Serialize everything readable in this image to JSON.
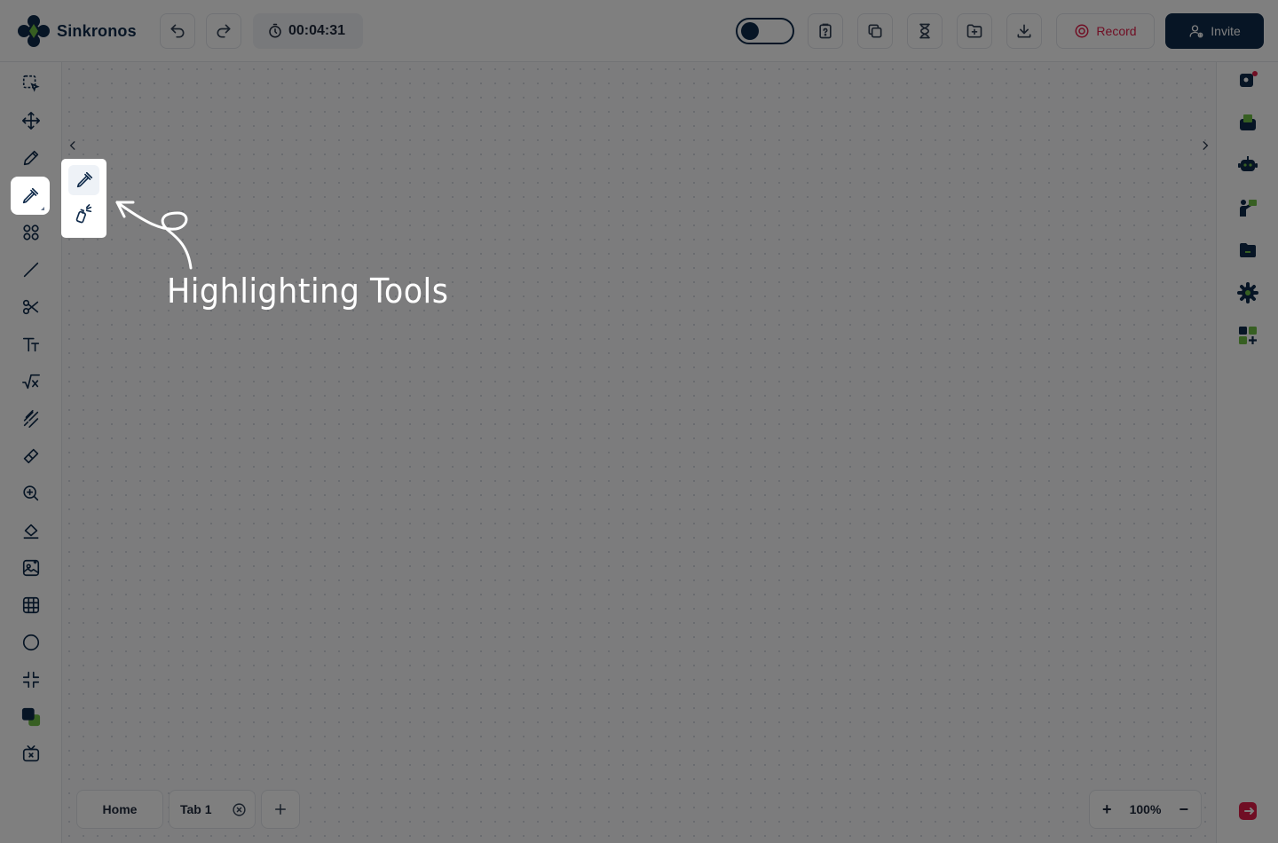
{
  "app": {
    "name": "Sinkronos"
  },
  "header": {
    "timer": "00:04:31",
    "record_label": "Record",
    "invite_label": "Invite"
  },
  "tabs": [
    {
      "label": "Home"
    },
    {
      "label": "Tab 1"
    }
  ],
  "zoom": {
    "level": "100%",
    "plus": "+",
    "minus": "−"
  },
  "annotation": {
    "text": "Highlighting Tools"
  },
  "colors": {
    "brand_navy": "#0f2a4a",
    "brand_green": "#6fbf44",
    "record_red": "#e11d48"
  }
}
